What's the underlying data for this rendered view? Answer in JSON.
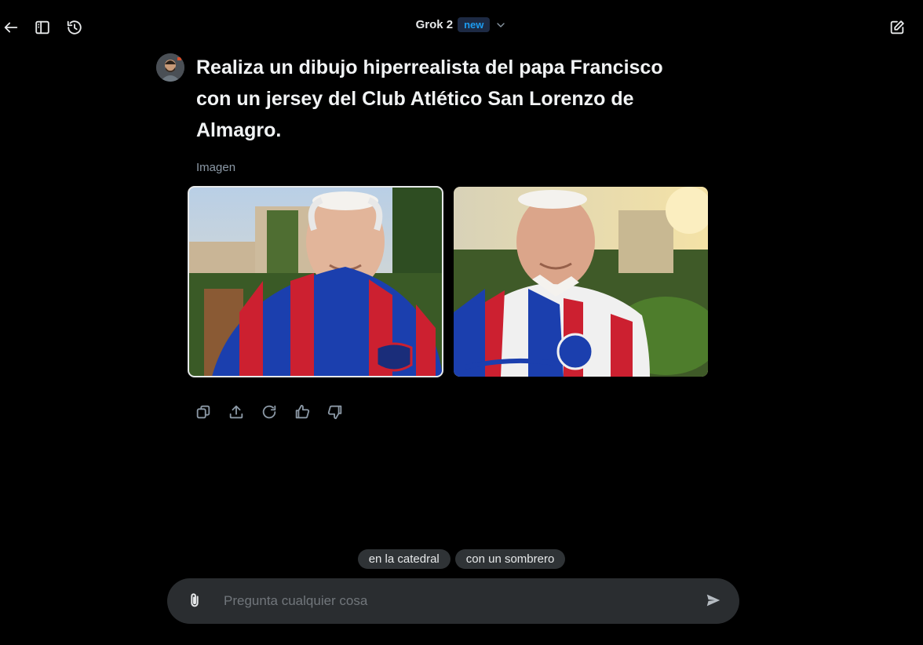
{
  "header": {
    "model_name": "Grok 2",
    "badge": "new"
  },
  "message": {
    "prompt": "Realiza un dibujo hiperrealista del papa Francisco con un jersey del Club Atlético San Lorenzo de Almagro.",
    "attachment_label": "Imagen"
  },
  "images": [
    {
      "name": "generated-image-1",
      "selected": true
    },
    {
      "name": "generated-image-2",
      "selected": false
    }
  ],
  "actions": [
    "copy-icon",
    "share-icon",
    "regenerate-icon",
    "thumbs-up-icon",
    "thumbs-down-icon"
  ],
  "suggestions": [
    "en la catedral",
    "con un sombrero"
  ],
  "composer": {
    "placeholder": "Pregunta cualquier cosa"
  },
  "colors": {
    "background": "#000000",
    "badge_text": "#1d9bf0",
    "composer_bg": "#2a2d30",
    "chip_bg": "#2f3336"
  }
}
